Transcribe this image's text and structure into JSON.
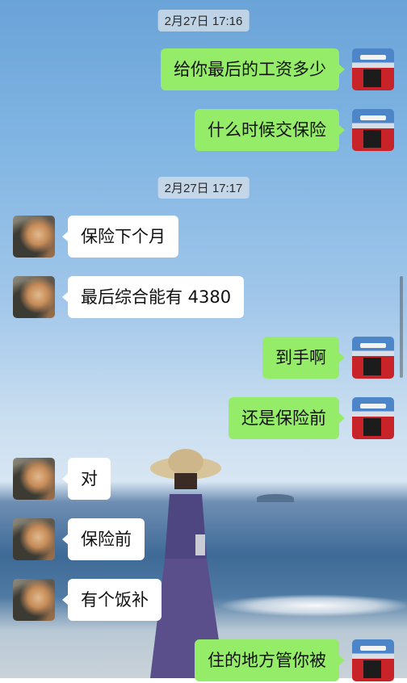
{
  "timestamps": [
    "2月27日 17:16",
    "2月27日 17:17"
  ],
  "messages": [
    {
      "side": "right",
      "text": "给你最后的工资多少"
    },
    {
      "side": "right",
      "text": "什么时候交保险"
    },
    {
      "side": "left",
      "text": "保险下个月"
    },
    {
      "side": "left",
      "text": "最后综合能有 4380"
    },
    {
      "side": "right",
      "text": "到手啊"
    },
    {
      "side": "right",
      "text": "还是保险前"
    },
    {
      "side": "left",
      "text": "对"
    },
    {
      "side": "left",
      "text": "保险前"
    },
    {
      "side": "left",
      "text": "有个饭补"
    },
    {
      "side": "right",
      "text": "住的地方管你被"
    }
  ],
  "colors": {
    "outgoing_bubble": "#95ec69",
    "incoming_bubble": "#ffffff",
    "timestamp_chip": "#cedae8"
  },
  "avatars": {
    "me": "bus-photo-avatar",
    "other": "person-photo-avatar"
  }
}
